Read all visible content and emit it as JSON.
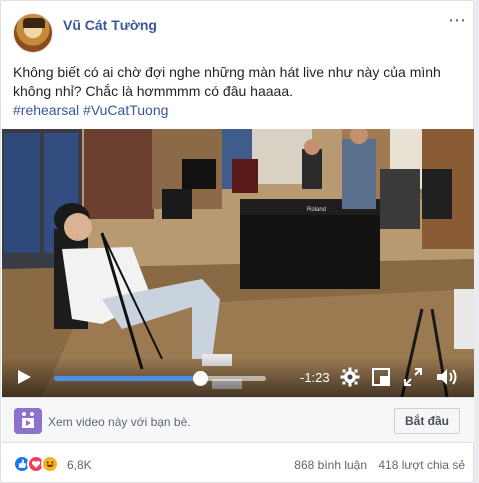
{
  "post": {
    "author": "Vũ Cát Tường",
    "more_icon": "⋯",
    "text_line1": "Không biết có ai chờ đợi nghe những màn hát live như này của mình",
    "text_line2": "không nhỉ? Chắc là hơmmmm có đâu haaaa.",
    "hashtags": "#rehearsal #VuCatTuong"
  },
  "video": {
    "scene_labels": {
      "piano_brand": "Roland"
    },
    "progress": 0.69,
    "time_remaining": "-1:23",
    "icons": [
      "play-icon",
      "gear-icon",
      "picture-in-picture-icon",
      "fullscreen-icon",
      "volume-icon"
    ]
  },
  "watch_party": {
    "text": "Xem video này với bạn bè.",
    "start_button": "Bắt đầu",
    "accent": "#8c72cb"
  },
  "reactions": {
    "count": "6,8K",
    "comments": "868 bình luận",
    "shares": "418 lượt chia sẻ",
    "colors": {
      "like": "#1877f2",
      "love": "#f33e58",
      "haha": "#f7b125"
    }
  }
}
